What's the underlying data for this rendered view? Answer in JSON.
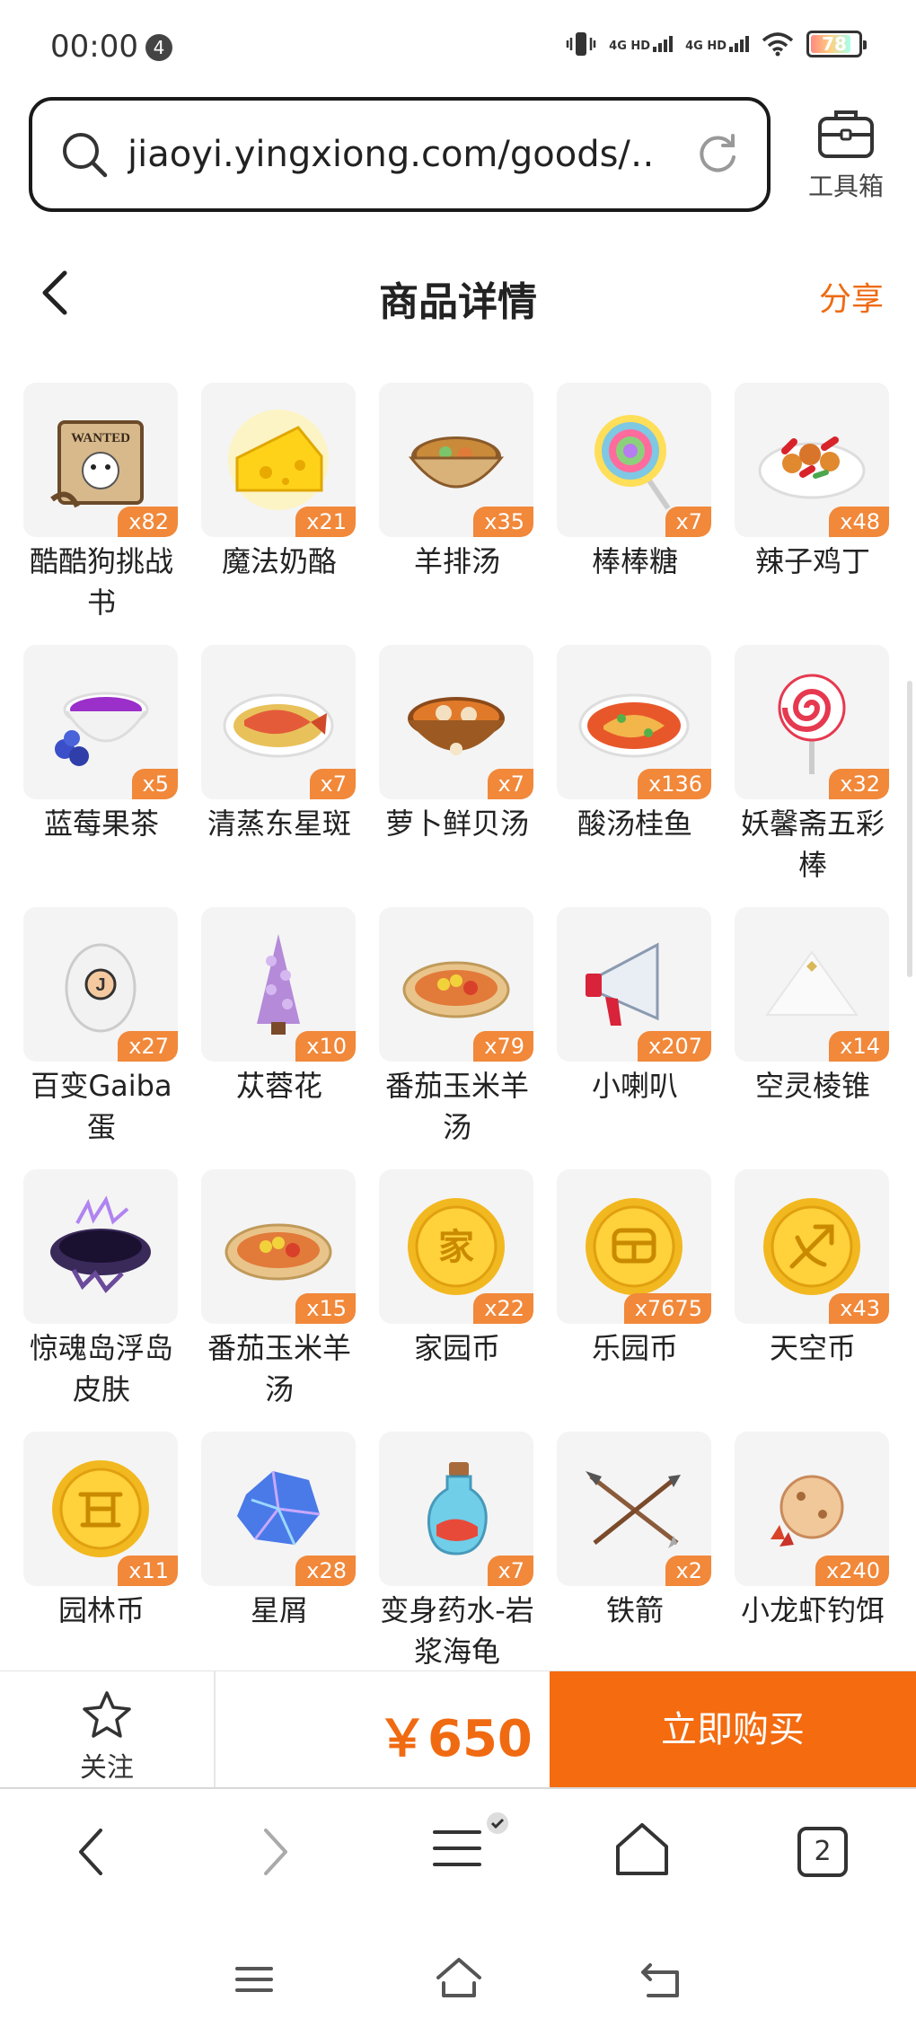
{
  "status": {
    "time": "00:00",
    "notif_count": "4",
    "net1": "4G HD",
    "net2": "4G HD",
    "battery": "78"
  },
  "browser": {
    "url": "jiaoyi.yingxiong.com/goods/…",
    "toolbox_label": "工具箱"
  },
  "header": {
    "title": "商品详情",
    "share": "分享"
  },
  "items": [
    {
      "name": "酷酷狗挑战书",
      "count": "x82",
      "icon": "wanted-scroll-icon"
    },
    {
      "name": "魔法奶酪",
      "count": "x21",
      "icon": "cheese-icon"
    },
    {
      "name": "羊排汤",
      "count": "x35",
      "icon": "soup-bowl-icon"
    },
    {
      "name": "棒棒糖",
      "count": "x7",
      "icon": "lollipop-icon"
    },
    {
      "name": "辣子鸡丁",
      "count": "x48",
      "icon": "spicy-chicken-plate-icon"
    },
    {
      "name": "蓝莓果茶",
      "count": "x5",
      "icon": "blueberry-tea-icon"
    },
    {
      "name": "清蒸东星斑",
      "count": "x7",
      "icon": "steamed-fish-icon"
    },
    {
      "name": "萝卜鲜贝汤",
      "count": "x7",
      "icon": "scallop-soup-icon"
    },
    {
      "name": "酸汤桂鱼",
      "count": "x136",
      "icon": "sour-fish-soup-icon"
    },
    {
      "name": "妖馨斋五彩棒",
      "count": "x32",
      "icon": "swirl-lollipop-icon"
    },
    {
      "name": "百变Gaiba蛋",
      "count": "x27",
      "icon": "egg-icon"
    },
    {
      "name": "苁蓉花",
      "count": "x10",
      "icon": "cistanche-flower-icon"
    },
    {
      "name": "番茄玉米羊汤",
      "count": "x79",
      "icon": "tomato-corn-soup-icon"
    },
    {
      "name": "小喇叭",
      "count": "x207",
      "icon": "megaphone-icon"
    },
    {
      "name": "空灵棱锥",
      "count": "x14",
      "icon": "pyramid-icon"
    },
    {
      "name": "惊魂岛浮岛皮肤",
      "count": "",
      "icon": "floating-island-icon"
    },
    {
      "name": "番茄玉米羊汤",
      "count": "x15",
      "icon": "tomato-corn-soup-icon"
    },
    {
      "name": "家园币",
      "count": "x22",
      "icon": "home-coin-icon"
    },
    {
      "name": "乐园币",
      "count": "x7675",
      "icon": "park-coin-icon"
    },
    {
      "name": "天空币",
      "count": "x43",
      "icon": "sky-coin-icon"
    },
    {
      "name": "园林币",
      "count": "x11",
      "icon": "garden-coin-icon"
    },
    {
      "name": "星屑",
      "count": "x28",
      "icon": "stardust-crystal-icon"
    },
    {
      "name": "变身药水-岩浆海龟",
      "count": "x7",
      "icon": "potion-bottle-icon"
    },
    {
      "name": "铁箭",
      "count": "x2",
      "icon": "iron-arrows-icon"
    },
    {
      "name": "小龙虾钓饵",
      "count": "x240",
      "icon": "crayfish-bait-icon"
    }
  ],
  "buy_bar": {
    "follow_label": "关注",
    "price": "￥650",
    "buy_label": "立即购买"
  },
  "browser_nav": {
    "tab_count": "2"
  },
  "colors": {
    "accent": "#f46b10",
    "badge": "#f1883a"
  }
}
